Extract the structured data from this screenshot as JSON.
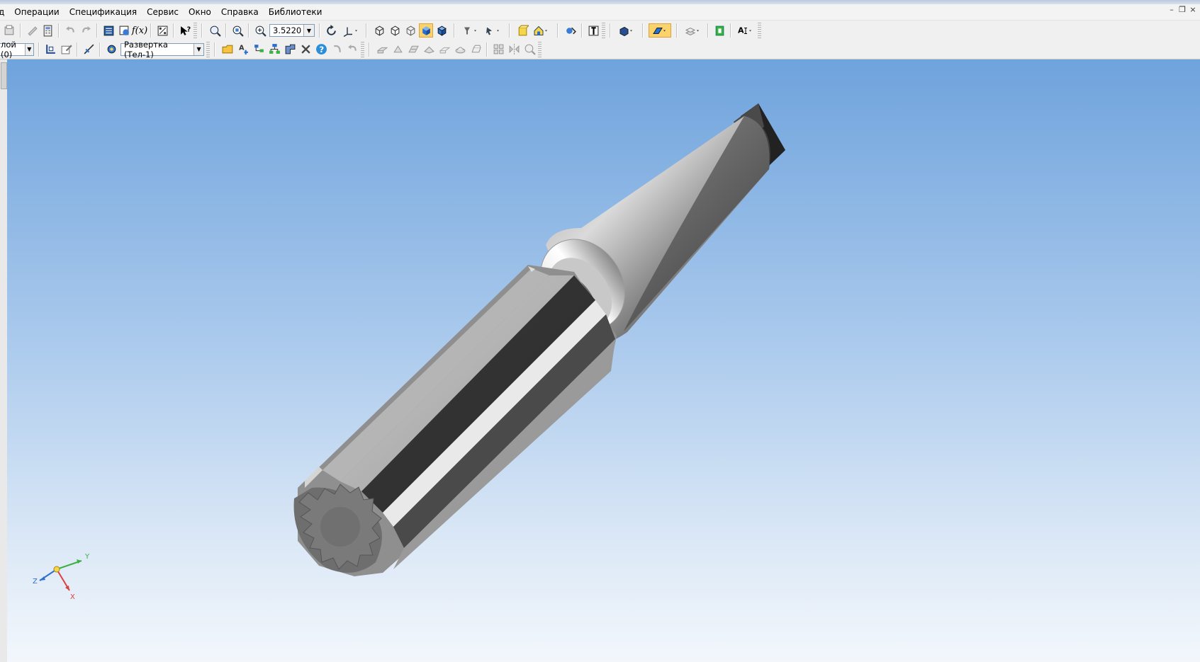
{
  "menu": {
    "items": [
      "д",
      "Операции",
      "Спецификация",
      "Сервис",
      "Окно",
      "Справка",
      "Библиотеки"
    ]
  },
  "window_controls": {
    "minimize": "–",
    "restore": "❐",
    "close": "×"
  },
  "toolbar1": {
    "zoom_value": "3.5220",
    "fx_label": "f(x)"
  },
  "toolbar2": {
    "layer_combo": "лой (0)",
    "body_combo": "Развертка (Тел-1)"
  },
  "triad": {
    "x": "X",
    "y": "Y",
    "z": "Z"
  },
  "colors": {
    "viewport_top": "#6fa3dc",
    "viewport_bottom": "#f3f7fc",
    "active_button": "#fbd36a",
    "axis_x": "#d94040",
    "axis_y": "#3cb043",
    "axis_z": "#2f6fd0"
  }
}
